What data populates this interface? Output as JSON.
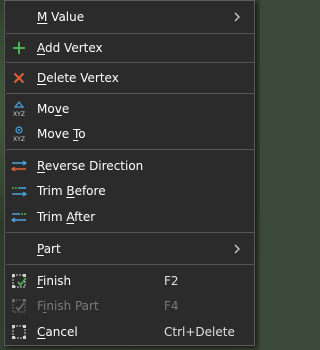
{
  "menu": {
    "items": [
      {
        "key": "m_value",
        "pre": "",
        "ul": "M",
        "post": " Value",
        "submenu": true
      },
      {
        "key": "add_vertex",
        "pre": "",
        "ul": "A",
        "post": "dd Vertex",
        "icon": "plus-icon"
      },
      {
        "key": "delete_vertex",
        "pre": "",
        "ul": "D",
        "post": "elete Vertex",
        "icon": "x-icon"
      },
      {
        "key": "move",
        "pre": "Mo",
        "ul": "v",
        "post": "e",
        "icon": "move-xyz-icon"
      },
      {
        "key": "move_to",
        "pre": "Move ",
        "ul": "T",
        "post": "o",
        "icon": "move-to-xyz-icon"
      },
      {
        "key": "reverse_direction",
        "pre": "",
        "ul": "R",
        "post": "everse Direction",
        "icon": "reverse-direction-icon"
      },
      {
        "key": "trim_before",
        "pre": "Trim ",
        "ul": "B",
        "post": "efore",
        "icon": "trim-before-icon"
      },
      {
        "key": "trim_after",
        "pre": "Trim ",
        "ul": "A",
        "post": "fter",
        "icon": "trim-after-icon"
      },
      {
        "key": "part",
        "pre": "",
        "ul": "P",
        "post": "art",
        "submenu": true
      },
      {
        "key": "finish",
        "pre": "",
        "ul": "F",
        "post": "inish",
        "icon": "finish-icon",
        "shortcut": "F2"
      },
      {
        "key": "finish_part",
        "pre": "F",
        "ul": "i",
        "post": "nish Part",
        "icon": "finish-part-icon",
        "shortcut": "F4",
        "disabled": true
      },
      {
        "key": "cancel",
        "pre": "",
        "ul": "C",
        "post": "ancel",
        "icon": "cancel-icon",
        "shortcut": "Ctrl+Delete"
      }
    ]
  },
  "colors": {
    "menu_bg": "#2b2b2b",
    "text": "#ffffff",
    "disabled_text": "#7a7a7a",
    "separator": "#555555",
    "add_green": "#4caf50",
    "delete_red": "#e0603a",
    "accent_blue": "#4aa3df"
  }
}
